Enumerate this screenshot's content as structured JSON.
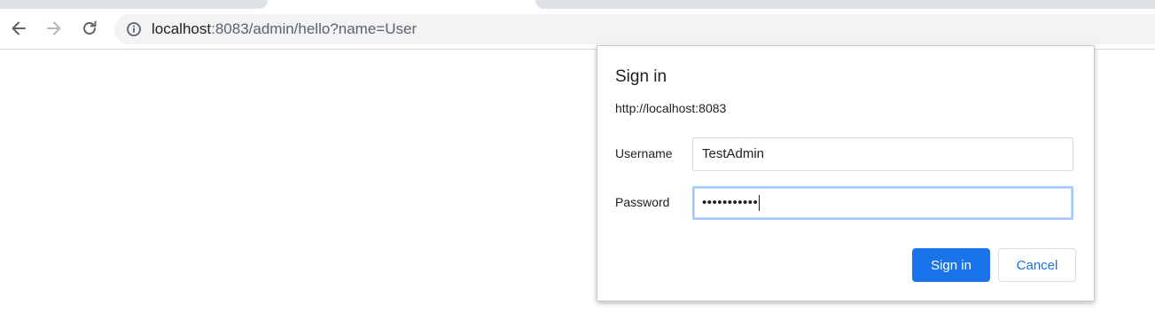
{
  "browser": {
    "url_host": "localhost",
    "url_rest": ":8083/admin/hello?name=User"
  },
  "dialog": {
    "title": "Sign in",
    "origin": "http://localhost:8083",
    "username_label": "Username",
    "username_value": "TestAdmin",
    "password_label": "Password",
    "password_masked": "•••••••••••",
    "signin_label": "Sign in",
    "cancel_label": "Cancel"
  },
  "colors": {
    "accent": "#1a73e8",
    "focus_border": "#a8c7fa"
  },
  "icons": {
    "back": "arrow-left-icon",
    "forward": "arrow-right-icon",
    "reload": "reload-icon",
    "site_info": "info-icon"
  }
}
